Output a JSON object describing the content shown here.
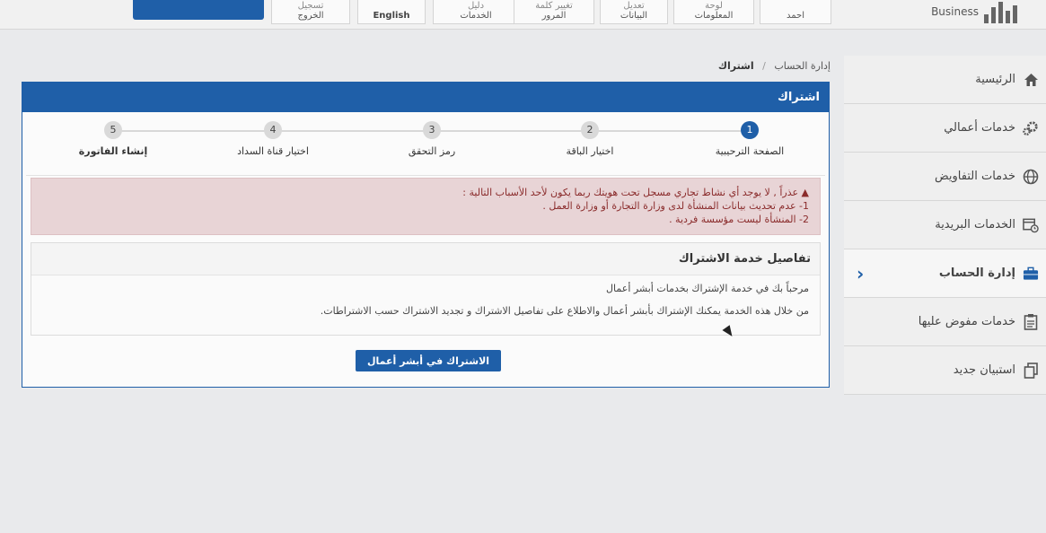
{
  "topbar": {
    "logout": {
      "top": "تسجيل",
      "label": "الخروج"
    },
    "language": "English",
    "services": {
      "top": "دليل",
      "label": "الخدمات"
    },
    "password": {
      "top": "تغيير كلمة",
      "label": "المرور"
    },
    "edit_data": {
      "top": "تعديل",
      "label": "البيانات"
    },
    "dashboard": {
      "top": "لوحة",
      "label": "المعلومات"
    },
    "user": "احمد",
    "brand": "Business"
  },
  "sidebar": {
    "items": [
      {
        "label": "الرئيسية",
        "icon": "home-icon"
      },
      {
        "label": "خدمات أعمالي",
        "icon": "gears-icon"
      },
      {
        "label": "خدمات التفاويض",
        "icon": "globe-icon"
      },
      {
        "label": "الخدمات البريدية",
        "icon": "calendar-clock-icon"
      },
      {
        "label": "إدارة الحساب",
        "icon": "briefcase-icon"
      },
      {
        "label": "خدمات مفوض عليها",
        "icon": "clipboard-icon"
      },
      {
        "label": "استبيان جديد",
        "icon": "copy-icon"
      }
    ]
  },
  "breadcrumb": {
    "parent": "إدارة الحساب",
    "current": "اشتراك"
  },
  "panel": {
    "title": "اشتراك"
  },
  "steps": [
    {
      "num": "1",
      "label": "الصفحة الترحيبية"
    },
    {
      "num": "2",
      "label": "اختيار الباقة"
    },
    {
      "num": "3",
      "label": "رمز التحقق"
    },
    {
      "num": "4",
      "label": "اختيار قناة السداد"
    },
    {
      "num": "5",
      "label": "إنشاء الفاتورة"
    }
  ],
  "alert": {
    "line1": "عذراً , لا يوجد أي نشاط تجاري مسجل تحت هويتك ربما يكون لأحد الأسباب التالية :",
    "line2": "1- عدم تحديث بيانات المنشأة لدى وزارة التجارة أو وزارة العمل .",
    "line3": "2- المنشأة ليست مؤسسة فردية ."
  },
  "details": {
    "title": "تفاصيل خدمة الاشتراك",
    "p1": "مرحباً بك في خدمة الإشتراك بخدمات أبشر أعمال",
    "p2": "من خلال هذه الخدمة يمكنك الإشتراك بأبشر أعمال والاطلاع على تفاصيل الاشتراك و تجديد الاشتراك حسب الاشتراطات."
  },
  "cta": {
    "label": "الاشتراك في أبشر أعمال"
  }
}
